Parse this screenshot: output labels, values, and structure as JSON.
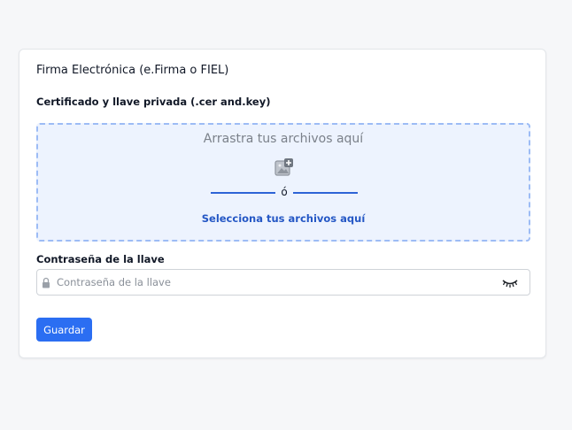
{
  "card": {
    "title": "Firma Electrónica (e.Firma o FIEL)"
  },
  "upload": {
    "section_label": "Certificado y llave privada (.cer and.key)",
    "drop_text": "Arrastra tus archivos aquí",
    "icon": "image-add-icon",
    "divider_text": "ó",
    "select_link": "Selecciona tus archivos aquí"
  },
  "password": {
    "label": "Contraseña de la llave",
    "placeholder": "Contraseña de la llave",
    "value": "",
    "lock_icon": "lock-icon",
    "toggle_icon": "eye-closed-icon"
  },
  "actions": {
    "save_label": "Guardar"
  },
  "colors": {
    "accent": "#2b6ef2",
    "link": "#2457c5",
    "dropzone_bg": "#edf3fe",
    "dropzone_border": "#9dbcf5"
  }
}
